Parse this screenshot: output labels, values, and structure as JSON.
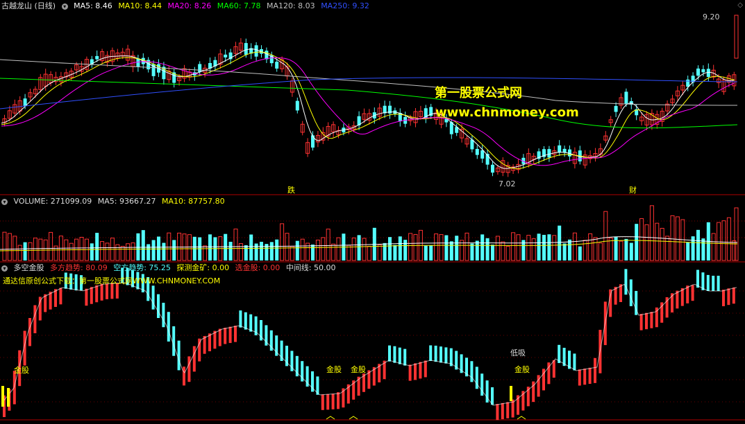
{
  "main_header": {
    "stock": "古越龙山 (日线)",
    "ma5": "MA5: 8.46",
    "ma10": "MA10: 8.44",
    "ma20": "MA20: 8.26",
    "ma60": "MA60: 7.78",
    "ma120": "MA120: 8.03",
    "ma250": "MA250: 9.32"
  },
  "price_labels": {
    "high": "9.20",
    "low": "7.02"
  },
  "event_marks": {
    "die": "跌",
    "cai": "财"
  },
  "watermark": {
    "line1": "第一股票公式网",
    "line2": "www.chnmoney.com"
  },
  "volume_header": {
    "volume": "VOLUME: 271099.09",
    "ma5": "MA5: 93667.27",
    "ma10": "MA10: 87757.80"
  },
  "indicator_header": {
    "name": "多空金股",
    "long": "多方趋势: 80.09",
    "short": "空方趋势: 75.25",
    "probe": "探测金矿: 0.00",
    "pick": "选金股: 0.00",
    "mid": "中间线: 50.00"
  },
  "indicator_note": "通达信原创公式下载：第一股票公式网WWW.CHNMONEY.COM",
  "signals": {
    "gold1": "金股",
    "gold2": "金股",
    "gold3": "金股",
    "gold4": "金股",
    "low_buy": "低吸"
  },
  "colors": {
    "up": "#ff3232",
    "down": "#54ffff",
    "ma5": "#ffffff",
    "ma10": "#ffff00",
    "ma20": "#ff00ff",
    "ma60": "#00ff00",
    "ma120": "#c0c0c0",
    "ma250": "#3050ff",
    "panel_border": "#b00000"
  }
}
